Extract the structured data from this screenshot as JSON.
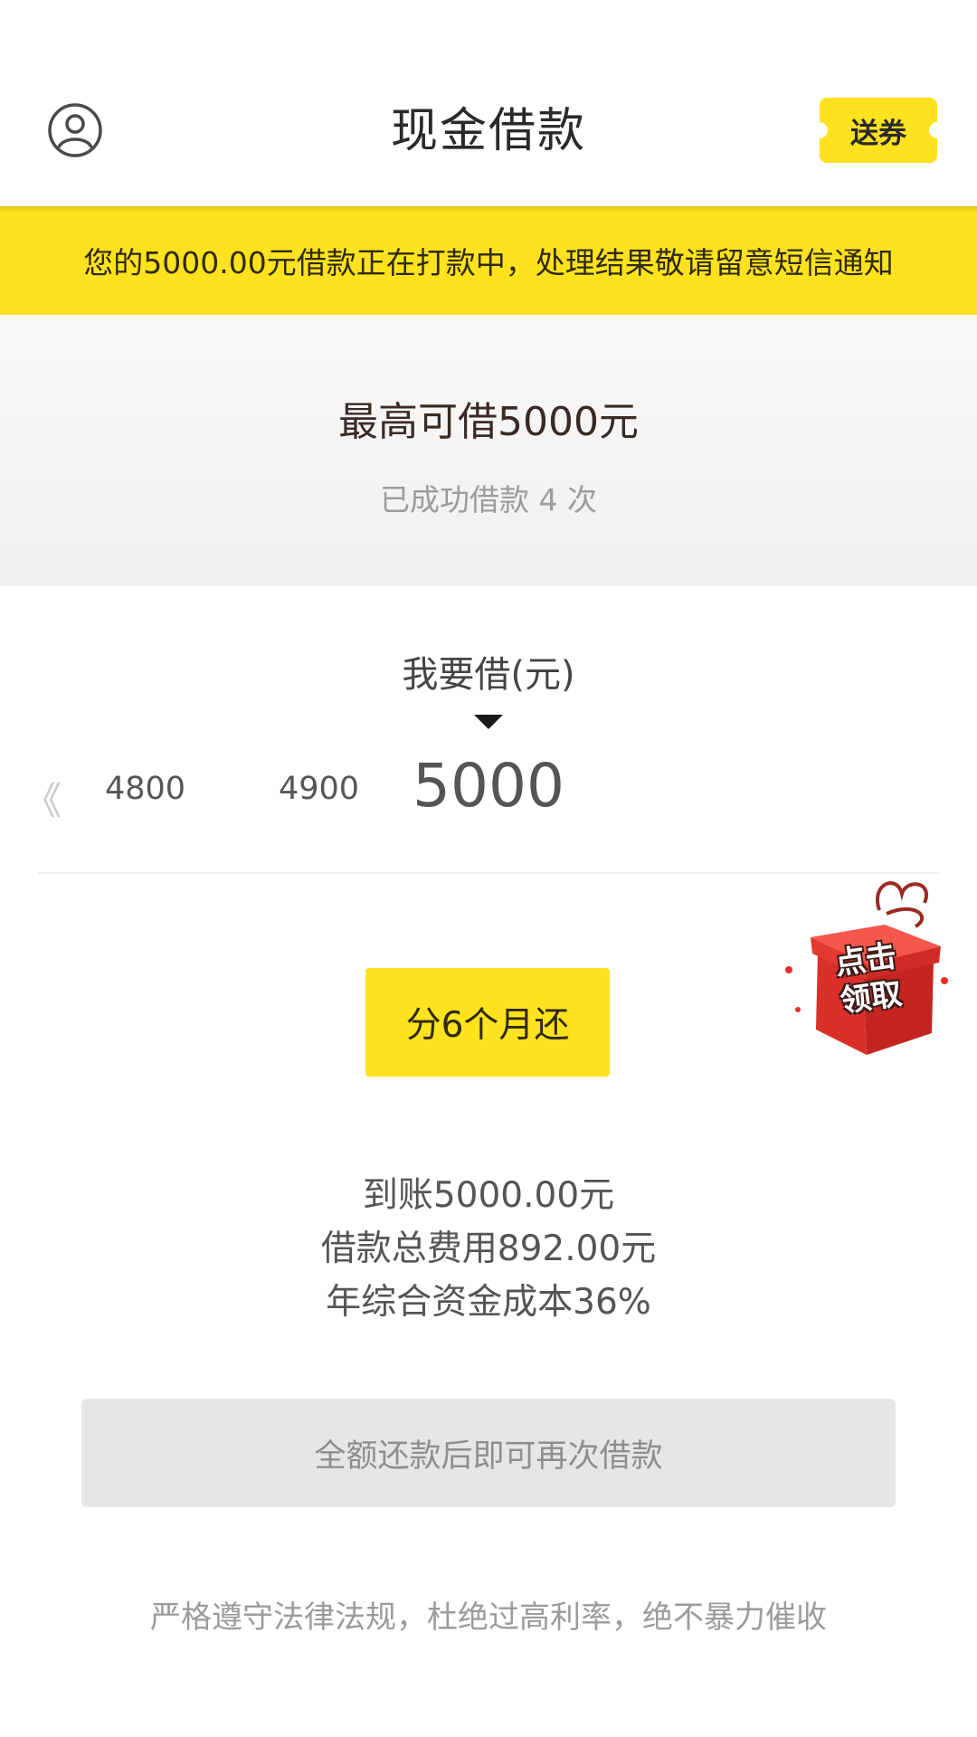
{
  "header": {
    "title": "现金借款",
    "coupon_label": "送券"
  },
  "notice": {
    "text": "您的5000.00元借款正在打款中，处理结果敬请留意短信通知"
  },
  "summary": {
    "max_amount": "最高可借5000元",
    "borrow_count": "已成功借款 4 次"
  },
  "picker": {
    "label": "我要借(元)",
    "prev_glyph": "《",
    "options": [
      "4800",
      "4900"
    ],
    "selected": "5000"
  },
  "gift": {
    "text_line1": "点击",
    "text_line2": "领取"
  },
  "term": {
    "label": "分6个月还"
  },
  "details": {
    "received": "到账5000.00元",
    "total_fee": "借款总费用892.00元",
    "annual_cost": "年综合资金成本36%"
  },
  "action": {
    "label": "全额还款后即可再次借款"
  },
  "footer": {
    "note": "严格遵守法律法规，杜绝过高利率，绝不暴力催收"
  },
  "colors": {
    "accent": "#ffe21e",
    "gift_red": "#e8312a"
  }
}
